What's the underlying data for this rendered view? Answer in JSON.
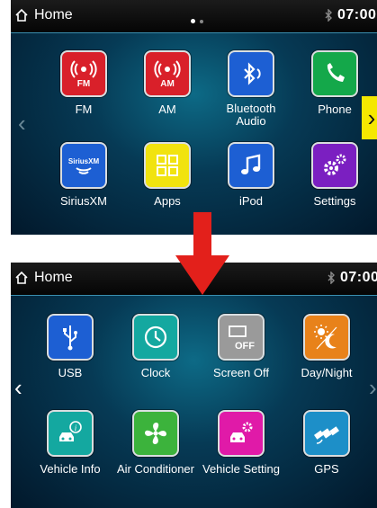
{
  "top_screen": {
    "header": {
      "home_label": "Home",
      "time": "07:00"
    },
    "apps": [
      {
        "label": "FM",
        "icon": "fm-radio-icon",
        "color": "#d9202a"
      },
      {
        "label": "AM",
        "icon": "am-radio-icon",
        "color": "#d9202a"
      },
      {
        "label": "Bluetooth\nAudio",
        "icon": "bluetooth-audio-icon",
        "color": "#1d5fd3"
      },
      {
        "label": "Phone",
        "icon": "phone-icon",
        "color": "#14a84a"
      },
      {
        "label": "SiriusXM",
        "icon": "siriusxm-icon",
        "color": "#1d5fd3"
      },
      {
        "label": "Apps",
        "icon": "apps-grid-icon",
        "color": "#f1e30f"
      },
      {
        "label": "iPod",
        "icon": "music-note-icon",
        "color": "#1d5fd3"
      },
      {
        "label": "Settings",
        "icon": "gears-icon",
        "color": "#7b1fc1"
      }
    ],
    "page_indicator": {
      "pages": 2,
      "current": 1
    }
  },
  "bottom_screen": {
    "header": {
      "home_label": "Home",
      "time": "07:00"
    },
    "apps": [
      {
        "label": "USB",
        "icon": "usb-icon",
        "color": "#1d5fd3"
      },
      {
        "label": "Clock",
        "icon": "clock-icon",
        "color": "#14a8a0"
      },
      {
        "label": "Screen Off",
        "icon": "screen-off-icon",
        "color": "#9a9a9a"
      },
      {
        "label": "Day/Night",
        "icon": "day-night-icon",
        "color": "#e8821a"
      },
      {
        "label": "Vehicle Info",
        "icon": "vehicle-info-icon",
        "color": "#14a8a0"
      },
      {
        "label": "Air Conditioner",
        "icon": "fan-icon",
        "color": "#3cb33c"
      },
      {
        "label": "Vehicle Setting",
        "icon": "vehicle-setting-icon",
        "color": "#e01aa8"
      },
      {
        "label": "GPS",
        "icon": "satellite-icon",
        "color": "#1d8fc8"
      }
    ],
    "screen_off_text": "OFF"
  },
  "colors": {
    "highlight": "#f5e800",
    "transition_arrow": "#e3201b"
  }
}
